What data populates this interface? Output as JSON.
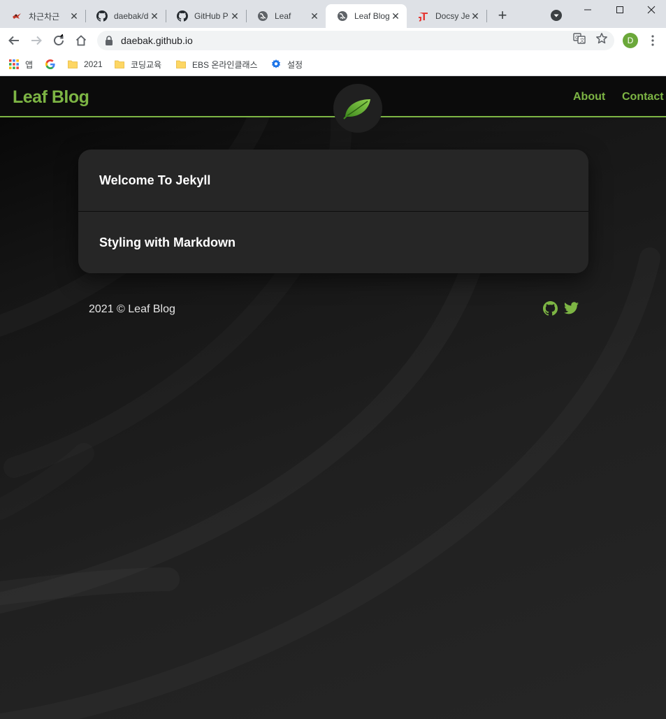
{
  "browser": {
    "tabs": [
      {
        "title": "차근차근"
      },
      {
        "title": "daebak/d"
      },
      {
        "title": "GitHub P"
      },
      {
        "title": "Leaf"
      },
      {
        "title": "Leaf Blog"
      },
      {
        "title": "Docsy Jek"
      }
    ],
    "url": "daebak.github.io",
    "profile_initial": "D",
    "bookmarks": [
      {
        "label": "앱"
      },
      {
        "label": "2021"
      },
      {
        "label": "코딩교육"
      },
      {
        "label": "EBS 온라인클래스"
      },
      {
        "label": "설정"
      }
    ],
    "colors": {
      "tabstrip": "#dee1e6",
      "omnibox": "#f1f3f4",
      "profile": "#6ba83a"
    }
  },
  "site": {
    "brand": "Leaf Blog",
    "nav": {
      "about": "About",
      "contact": "Contact"
    },
    "posts": [
      {
        "title": "Welcome To Jekyll"
      },
      {
        "title": "Styling with Markdown"
      }
    ],
    "footer": {
      "text": "2021 © Leaf Blog"
    },
    "social": [
      "github-icon",
      "twitter-icon"
    ],
    "colors": {
      "accent": "#7db544",
      "card": "#262626",
      "header": "#0b0b0b"
    }
  }
}
